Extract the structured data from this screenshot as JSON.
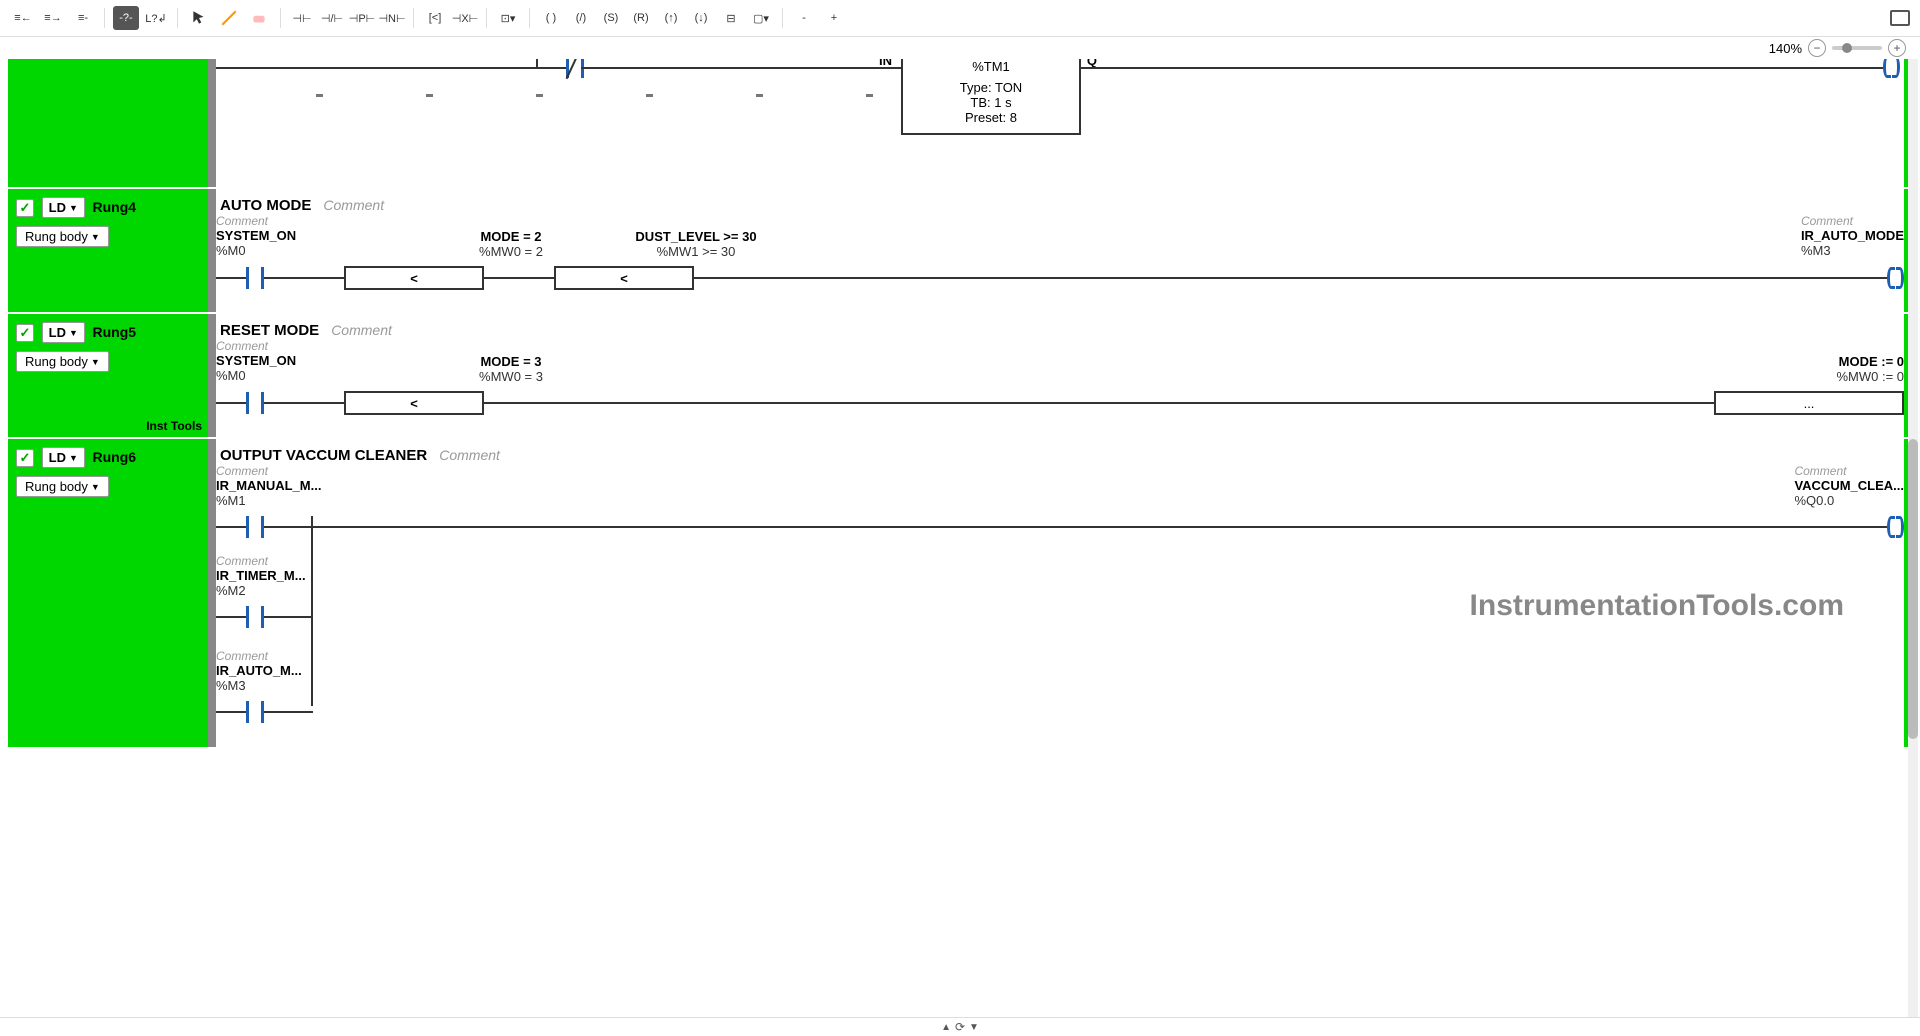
{
  "toolbar": {
    "zoom": "140%"
  },
  "timer_block": {
    "in": "IN",
    "q": "Q",
    "addr": "%TM1",
    "type_label": "Type:",
    "type_value": "TON",
    "tb_label": "TB:",
    "tb_value": "1 s",
    "preset_label": "Preset:",
    "preset_value": "8"
  },
  "rungs": [
    {
      "name": "Rung4",
      "ld": "LD",
      "body_btn": "Rung body",
      "title": "AUTO MODE",
      "comment_hint": "Comment",
      "contacts": [
        {
          "comment": "Comment",
          "label": "SYSTEM_ON",
          "addr": "%M0"
        },
        {
          "comment": "",
          "label": "MODE = 2",
          "addr": "%MW0 = 2",
          "compare": "<"
        },
        {
          "comment": "",
          "label": "DUST_LEVEL >= 30",
          "addr": "%MW1 >= 30",
          "compare": "<"
        }
      ],
      "coil": {
        "comment": "Comment",
        "label": "IR_AUTO_MODE",
        "addr": "%M3"
      }
    },
    {
      "name": "Rung5",
      "ld": "LD",
      "body_btn": "Rung body",
      "title": "RESET MODE",
      "comment_hint": "Comment",
      "watermark_side": "Inst Tools",
      "contacts": [
        {
          "comment": "Comment",
          "label": "SYSTEM_ON",
          "addr": "%M0"
        },
        {
          "comment": "",
          "label": "MODE = 3",
          "addr": "%MW0 = 3",
          "compare": "<"
        }
      ],
      "op": {
        "label": "MODE := 0",
        "addr": "%MW0 := 0",
        "dots": "..."
      }
    },
    {
      "name": "Rung6",
      "ld": "LD",
      "body_btn": "Rung body",
      "title": "OUTPUT VACCUM CLEANER",
      "comment_hint": "Comment",
      "branches": [
        {
          "comment": "Comment",
          "label": "IR_MANUAL_M...",
          "addr": "%M1"
        },
        {
          "comment": "Comment",
          "label": "IR_TIMER_M...",
          "addr": "%M2"
        },
        {
          "comment": "Comment",
          "label": "IR_AUTO_M...",
          "addr": "%M3"
        }
      ],
      "coil": {
        "comment": "Comment",
        "label": "VACCUM_CLEA...",
        "addr": "%Q0.0"
      },
      "watermark": "InstrumentationTools.com"
    }
  ]
}
